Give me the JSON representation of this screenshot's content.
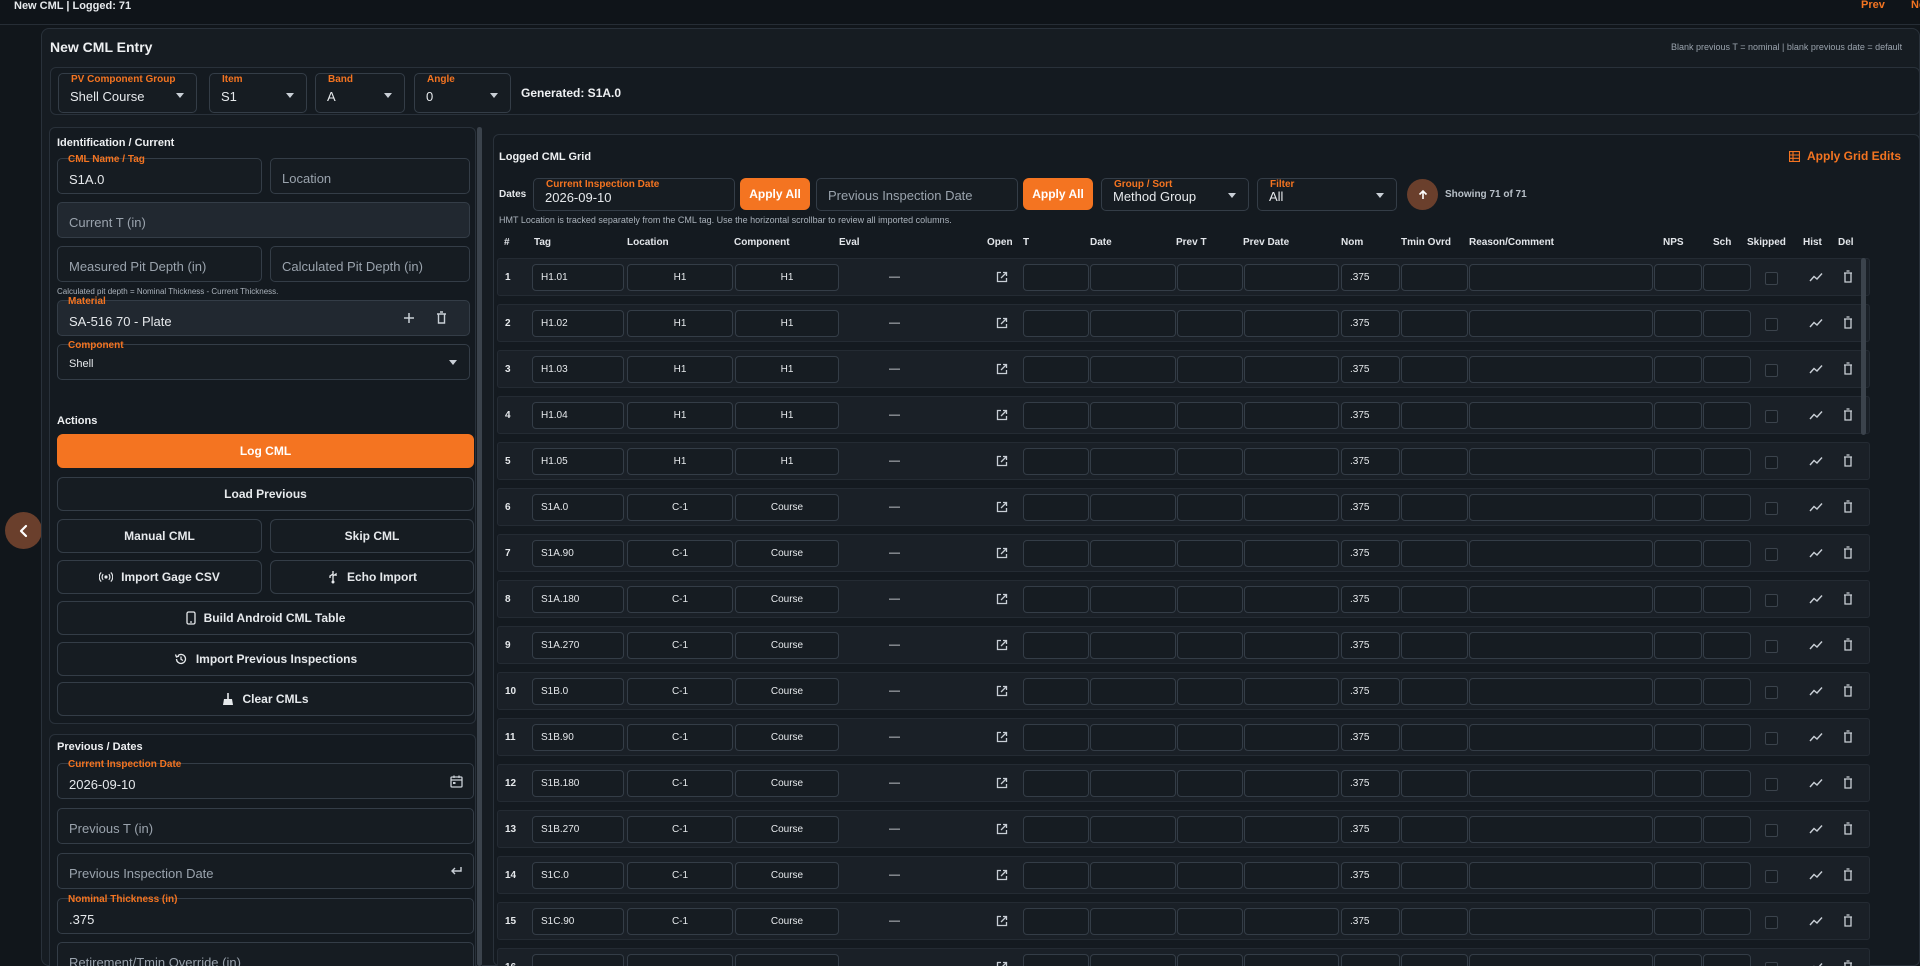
{
  "top_bar": {
    "title": "New CML  |  Logged: 71",
    "prev_label": "Prev",
    "edge_label": "Next"
  },
  "page": {
    "title": "New CML Entry",
    "hint": "Blank previous T = nominal | blank previous date = default"
  },
  "selectors": {
    "pv_group": {
      "label": "PV Component Group",
      "value": "Shell Course"
    },
    "item": {
      "label": "Item",
      "value": "S1"
    },
    "band": {
      "label": "Band",
      "value": "A"
    },
    "angle": {
      "label": "Angle",
      "value": "0"
    },
    "generated": "Generated: S1A.0"
  },
  "identification": {
    "title": "Identification / Current",
    "cml_name_label": "CML Name / Tag",
    "cml_name_value": "S1A.0",
    "location_placeholder": "Location",
    "current_t_placeholder": "Current T (in)",
    "measured_pit_placeholder": "Measured Pit Depth (in)",
    "calculated_pit_placeholder": "Calculated Pit Depth (in)",
    "pit_note": "Calculated pit depth = Nominal Thickness - Current Thickness.",
    "material_label": "Material",
    "material_value": "SA-516 70 - Plate",
    "component_label": "Component",
    "component_value": "Shell"
  },
  "actions": {
    "title": "Actions",
    "log_cml": "Log CML",
    "load_previous": "Load Previous",
    "manual_cml": "Manual CML",
    "skip_cml": "Skip CML",
    "import_gage_csv": "Import Gage CSV",
    "echo_import": "Echo Import",
    "build_android": "Build Android CML Table",
    "import_previous": "Import Previous Inspections",
    "clear_cmls": "Clear CMLs"
  },
  "previous": {
    "title": "Previous / Dates",
    "current_date_label": "Current Inspection Date",
    "current_date_value": "2026-09-10",
    "previous_t_placeholder": "Previous T (in)",
    "previous_date_placeholder": "Previous Inspection Date",
    "nominal_label": "Nominal Thickness (in)",
    "nominal_value": ".375",
    "retirement_placeholder": "Retirement/Tmin Override (in)"
  },
  "grid": {
    "title": "Logged CML Grid",
    "apply_grid_edits": "Apply Grid Edits",
    "dates_label": "Dates",
    "current_date_label": "Current Inspection Date",
    "current_date_value": "2026-09-10",
    "apply_all_1": "Apply All",
    "previous_date_placeholder": "Previous Inspection Date",
    "apply_all_2": "Apply All",
    "group_sort_label": "Group / Sort",
    "group_sort_value": "Method Group",
    "filter_label": "Filter",
    "filter_value": "All",
    "showing": "Showing 71 of 71",
    "note": "HMT Location is tracked separately from the CML tag. Use the horizontal scrollbar to review all imported columns.",
    "columns": {
      "num": "#",
      "tag": "Tag",
      "location": "Location",
      "component": "Component",
      "eval": "Eval",
      "open": "Open",
      "t": "T",
      "date": "Date",
      "prev_t": "Prev T",
      "prev_date": "Prev Date",
      "nom": "Nom",
      "tmin": "Tmin Ovrd",
      "reason": "Reason/Comment",
      "nps": "NPS",
      "sch": "Sch",
      "skipped": "Skipped",
      "hist": "Hist",
      "del": "Del"
    },
    "rows": [
      {
        "num": "1",
        "tag": "H1.01",
        "location": "H1",
        "component": "H1",
        "eval": "—",
        "nom": ".375"
      },
      {
        "num": "2",
        "tag": "H1.02",
        "location": "H1",
        "component": "H1",
        "eval": "—",
        "nom": ".375"
      },
      {
        "num": "3",
        "tag": "H1.03",
        "location": "H1",
        "component": "H1",
        "eval": "—",
        "nom": ".375"
      },
      {
        "num": "4",
        "tag": "H1.04",
        "location": "H1",
        "component": "H1",
        "eval": "—",
        "nom": ".375"
      },
      {
        "num": "5",
        "tag": "H1.05",
        "location": "H1",
        "component": "H1",
        "eval": "—",
        "nom": ".375"
      },
      {
        "num": "6",
        "tag": "S1A.0",
        "location": "C-1",
        "component": "Course",
        "eval": "—",
        "nom": ".375"
      },
      {
        "num": "7",
        "tag": "S1A.90",
        "location": "C-1",
        "component": "Course",
        "eval": "—",
        "nom": ".375"
      },
      {
        "num": "8",
        "tag": "S1A.180",
        "location": "C-1",
        "component": "Course",
        "eval": "—",
        "nom": ".375"
      },
      {
        "num": "9",
        "tag": "S1A.270",
        "location": "C-1",
        "component": "Course",
        "eval": "—",
        "nom": ".375"
      },
      {
        "num": "10",
        "tag": "S1B.0",
        "location": "C-1",
        "component": "Course",
        "eval": "—",
        "nom": ".375"
      },
      {
        "num": "11",
        "tag": "S1B.90",
        "location": "C-1",
        "component": "Course",
        "eval": "—",
        "nom": ".375"
      },
      {
        "num": "12",
        "tag": "S1B.180",
        "location": "C-1",
        "component": "Course",
        "eval": "—",
        "nom": ".375"
      },
      {
        "num": "13",
        "tag": "S1B.270",
        "location": "C-1",
        "component": "Course",
        "eval": "—",
        "nom": ".375"
      },
      {
        "num": "14",
        "tag": "S1C.0",
        "location": "C-1",
        "component": "Course",
        "eval": "—",
        "nom": ".375"
      },
      {
        "num": "15",
        "tag": "S1C.90",
        "location": "C-1",
        "component": "Course",
        "eval": "—",
        "nom": ".375"
      },
      {
        "num": "16",
        "tag": "",
        "location": "",
        "component": "",
        "eval": "",
        "nom": ""
      }
    ]
  },
  "colors": {
    "accent": "#f47421",
    "background": "#11161b",
    "panel": "#141a20",
    "field": "#161c22",
    "border": "#343d47"
  }
}
